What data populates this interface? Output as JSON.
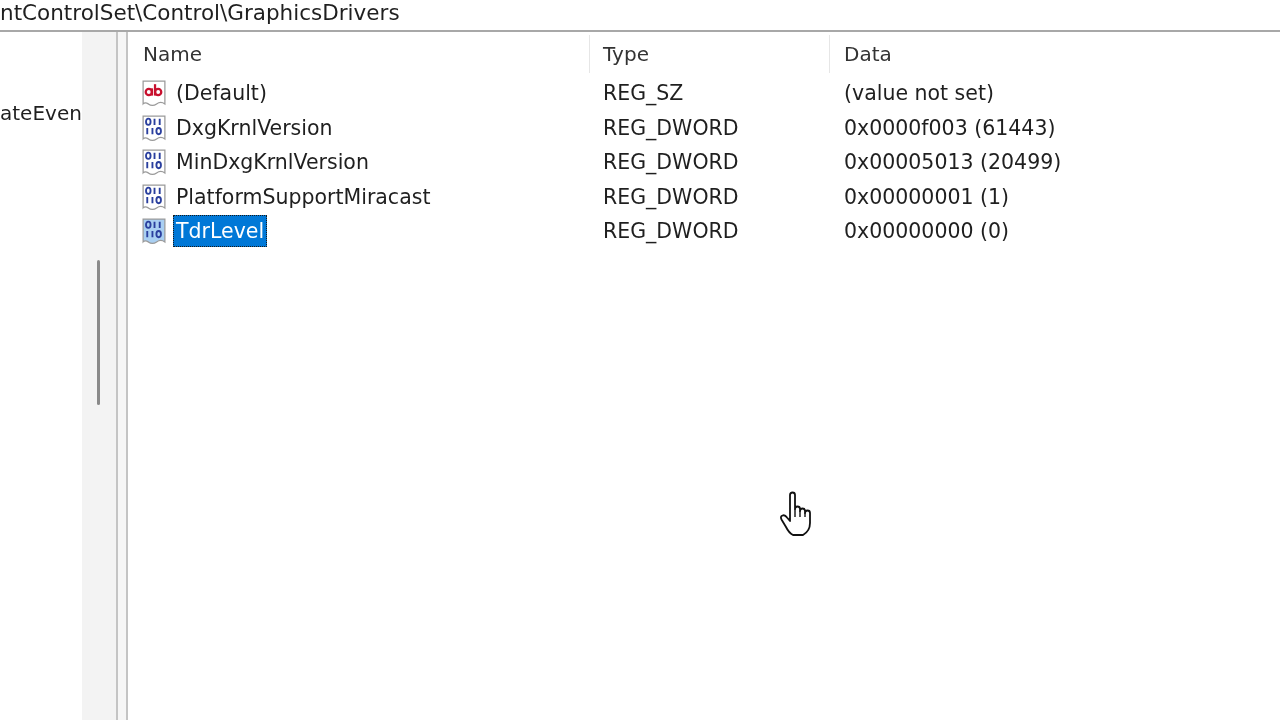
{
  "address_bar": {
    "path": "ntControlSet\\Control\\GraphicsDrivers"
  },
  "tree": {
    "items": [
      {
        "label": "ateEven"
      }
    ]
  },
  "values_list": {
    "columns": [
      "Name",
      "Type",
      "Data"
    ],
    "rows": [
      {
        "kind": "string",
        "name": "(Default)",
        "type": "REG_SZ",
        "data": "(value not set)",
        "selected": false
      },
      {
        "kind": "dword",
        "name": "DxgKrnlVersion",
        "type": "REG_DWORD",
        "data": "0x0000f003 (61443)",
        "selected": false
      },
      {
        "kind": "dword",
        "name": "MinDxgKrnlVersion",
        "type": "REG_DWORD",
        "data": "0x00005013 (20499)",
        "selected": false
      },
      {
        "kind": "dword",
        "name": "PlatformSupportMiracast",
        "type": "REG_DWORD",
        "data": "0x00000001 (1)",
        "selected": false
      },
      {
        "kind": "dword",
        "name": "TdrLevel",
        "type": "REG_DWORD",
        "data": "0x00000000 (0)",
        "selected": true
      }
    ]
  }
}
